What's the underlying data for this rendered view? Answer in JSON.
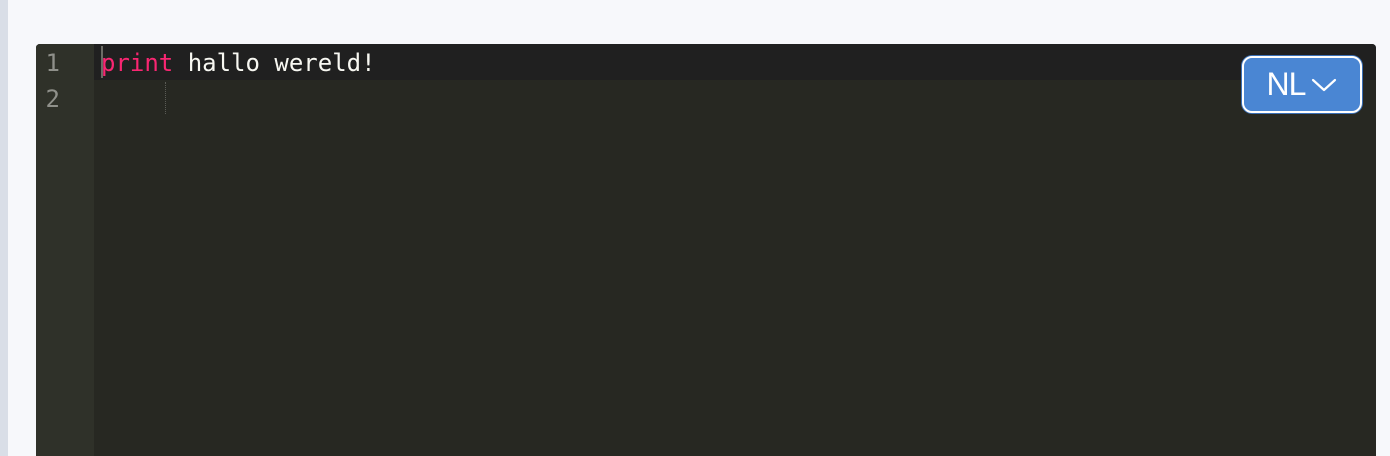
{
  "editor": {
    "gutter": [
      "1",
      "2"
    ],
    "lines": [
      {
        "keyword": "print",
        "text": " hallo wereld!"
      },
      {
        "keyword": "",
        "text": ""
      }
    ],
    "colors": {
      "background": "#272822",
      "keyword": "#f92672",
      "text": "#f8f8f2"
    }
  },
  "language_selector": {
    "label": "NL",
    "icon": "chevron-down-icon",
    "color": "#4a86d3"
  }
}
